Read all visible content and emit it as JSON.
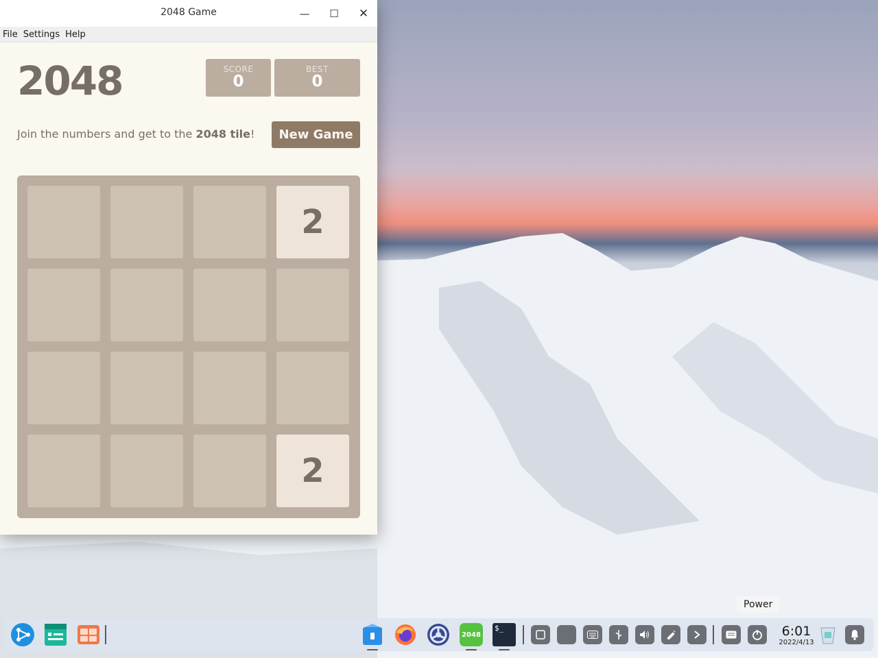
{
  "window": {
    "title": "2048 Game",
    "min_glyph": "—",
    "max_glyph": "☐",
    "close_glyph": "✕"
  },
  "menu": [
    "File",
    "Settings",
    "Help"
  ],
  "game": {
    "title": "2048",
    "score_label": "SCORE",
    "score_value": "0",
    "best_label": "BEST",
    "best_value": "0",
    "intro_pre": "Join the numbers and get to the ",
    "intro_bold": "2048 tile",
    "intro_post": "!",
    "new_game_label": "New Game",
    "grid": [
      [
        "",
        "",
        "",
        "2"
      ],
      [
        "",
        "",
        "",
        ""
      ],
      [
        "",
        "",
        "",
        ""
      ],
      [
        "",
        "",
        "",
        "2"
      ]
    ]
  },
  "tooltip": "Power",
  "taskbar": {
    "apps": [
      "launcher-icon",
      "file-manager-icon",
      "app-store-icon",
      "archive-icon",
      "firefox-icon",
      "settings-icon",
      "2048-icon",
      "terminal-icon"
    ],
    "app_2048_label": "2048",
    "terminal_label": "$_",
    "tray": [
      "window-icon",
      "workspace-icon",
      "keyboard-icon",
      "usb-icon",
      "volume-icon",
      "pen-icon",
      "chevron-right-icon",
      "input-method-icon",
      "power-icon"
    ],
    "time": "6:01",
    "date": "2022/4/13"
  },
  "colors": {
    "tile_empty": "#cdc1b4",
    "tile_2": "#eee4da",
    "board": "#bbada0",
    "button": "#8f7a66"
  }
}
